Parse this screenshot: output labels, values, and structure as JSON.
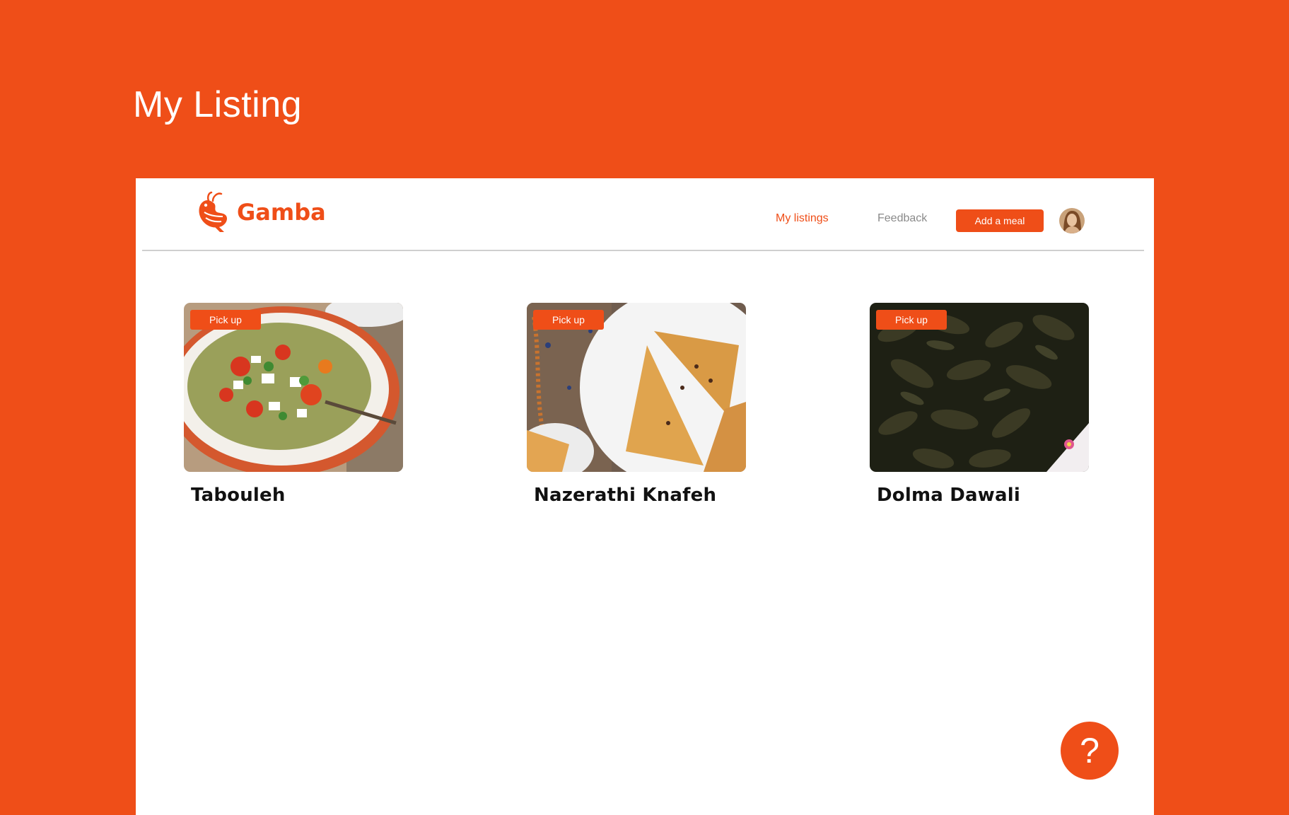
{
  "page": {
    "heading": "My Listing"
  },
  "brand": {
    "name": "Gamba",
    "color": "#EF4E18"
  },
  "nav": {
    "links": [
      {
        "label": "My listings",
        "active": true
      },
      {
        "label": "Feedback",
        "active": false
      }
    ],
    "add_button": "Add a meal",
    "avatar": "user-avatar"
  },
  "meals": [
    {
      "badge": "Pick up",
      "title": "Tabouleh",
      "image": "tabouleh-salad-photo"
    },
    {
      "badge": "Pick up",
      "title": "Nazerathi Knafeh",
      "image": "knafeh-pastry-photo"
    },
    {
      "badge": "Pick up",
      "title": "Dolma Dawali",
      "image": "stuffed-grape-leaves-photo"
    }
  ],
  "help": {
    "label": "?"
  },
  "colors": {
    "accent": "#EF4E18",
    "background": "#EF4E18",
    "surface": "#FFFFFF"
  }
}
